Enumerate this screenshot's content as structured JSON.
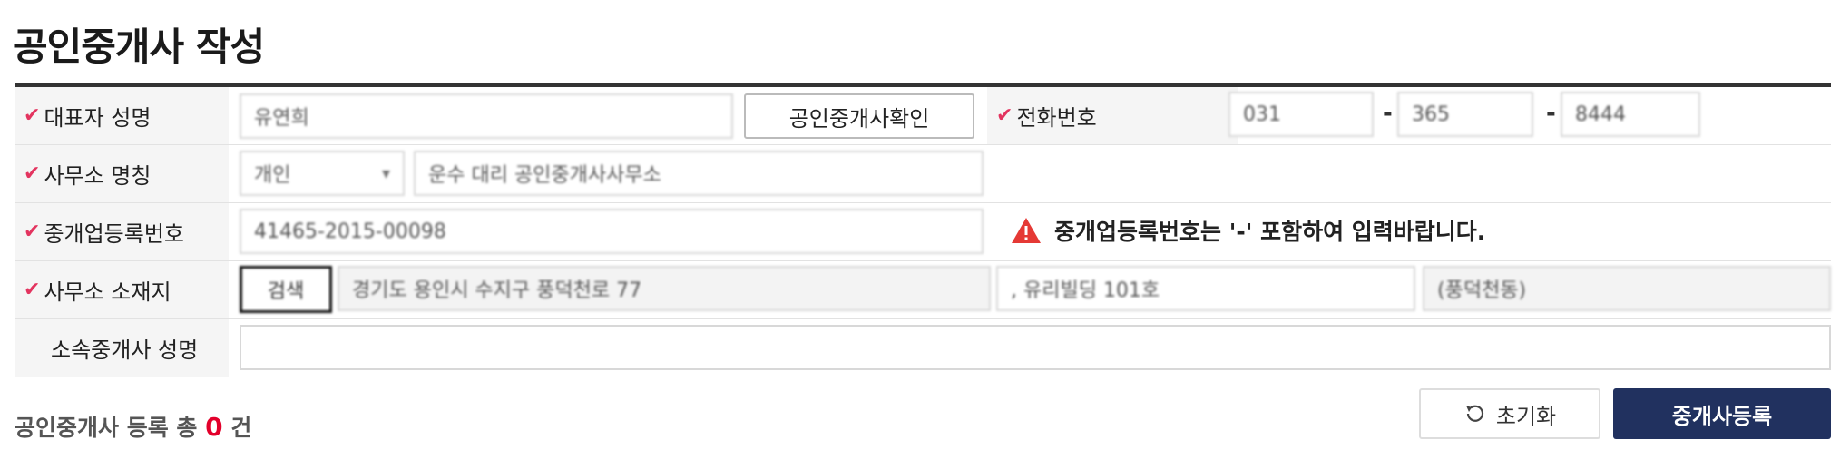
{
  "page": {
    "title": "공인중개사 작성"
  },
  "rows": {
    "representative": {
      "label": "대표자 성명",
      "value": "유연희",
      "verify_button": "공인중개사확인",
      "phone_label": "전화번호",
      "phone": [
        "031",
        "365",
        "8444"
      ],
      "phone_sep": "-"
    },
    "office_name": {
      "label": "사무소 명칭",
      "type_value": "개인",
      "value": "운수 대리 공인중개사사무소"
    },
    "registration": {
      "label": "중개업등록번호",
      "value": "41465-2015-00098",
      "warning": "중개업등록번호는 '-' 포함하여 입력바랍니다."
    },
    "location": {
      "label": "사무소 소재지",
      "search_button": "검색",
      "address": "경기도 용인시 수지구 풍덕천로 77",
      "address_detail": ", 유리빌딩 101호",
      "address_extra": "(풍덕천동)"
    },
    "agent": {
      "label": "소속중개사 성명",
      "value": ""
    }
  },
  "footer": {
    "count_prefix": "공인중개사 등록 총",
    "count_value": "0",
    "count_suffix": "건",
    "reset_label": "초기화",
    "submit_label": "중개사등록"
  },
  "colors": {
    "required_check": "#e3345f",
    "primary": "#21315f",
    "count": "#e3002b",
    "warning": "#e53935"
  },
  "icons": {
    "required": "check-icon",
    "warning": "warning-icon",
    "reset": "refresh-icon",
    "dropdown": "chevron-down-icon"
  }
}
